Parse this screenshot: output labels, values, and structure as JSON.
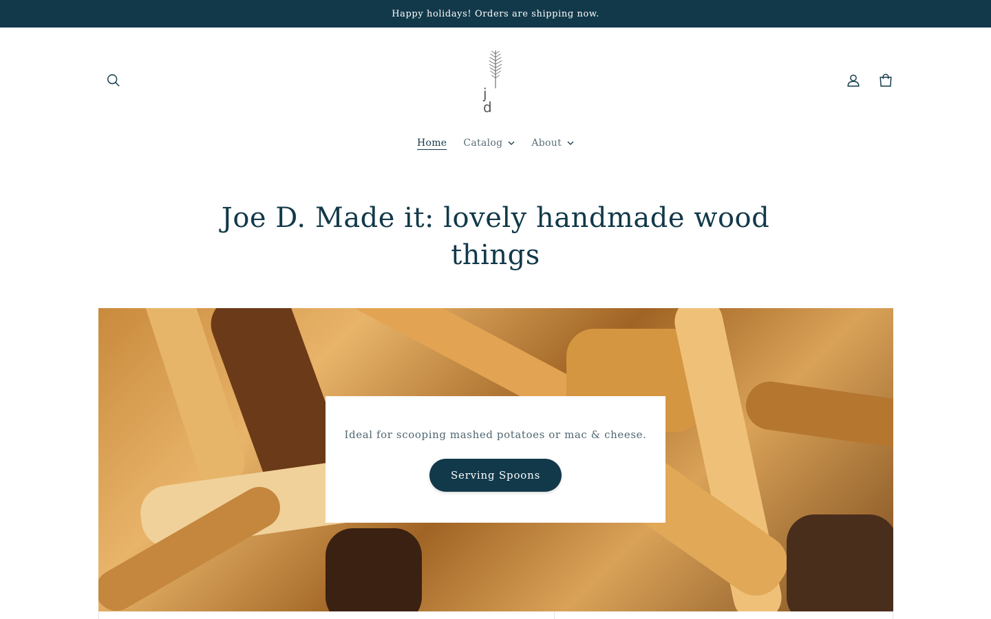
{
  "announcement": {
    "text": "Happy holidays! Orders are shipping now."
  },
  "header": {
    "logo_text": "j d",
    "icons": {
      "search": "search-icon",
      "account": "account-icon",
      "cart": "cart-icon"
    }
  },
  "nav": {
    "items": [
      {
        "label": "Home",
        "active": true,
        "has_dropdown": false
      },
      {
        "label": "Catalog",
        "active": false,
        "has_dropdown": true
      },
      {
        "label": "About",
        "active": false,
        "has_dropdown": true
      }
    ]
  },
  "headline": "Joe D. Made it: lovely handmade wood things",
  "hero": {
    "text": "Ideal for scooping mashed potatoes or mac & cheese.",
    "button_label": "Serving Spoons"
  },
  "colors": {
    "primary": "#12394a",
    "background": "#ffffff"
  }
}
